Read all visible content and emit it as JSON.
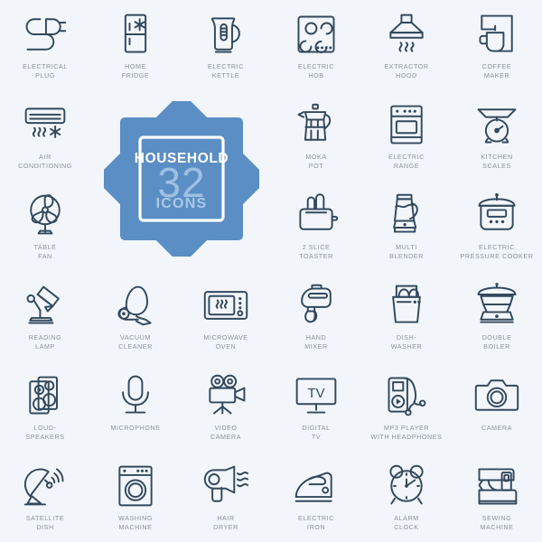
{
  "page": {
    "background_color": "#f2f6fb",
    "icon_stroke_color": "#33485c",
    "label_color": "#8b9199",
    "accent_color": "#5b8ec4",
    "columns": 6,
    "rows": 6
  },
  "badge": {
    "title": "HOUSEHOLD",
    "count": "32",
    "subtitle": "ICONS",
    "shape": "eight-point-star",
    "fill_color": "#5b8ec4",
    "frame_color": "#ffffff",
    "title_color": "#ffffff",
    "count_color": "#9dc0e2",
    "subtitle_color": "#a9c9e6"
  },
  "icons": [
    {
      "id": "electrical-plug",
      "label": "ELECTRICAL\nPLUG",
      "row": 1,
      "col": 1
    },
    {
      "id": "home-fridge",
      "label": "HOME\nFRIDGE",
      "row": 1,
      "col": 2
    },
    {
      "id": "electric-kettle",
      "label": "ELECTRIC\nKETTLE",
      "row": 1,
      "col": 3
    },
    {
      "id": "electric-hob",
      "label": "ELECTRIC\nHOB",
      "row": 1,
      "col": 4
    },
    {
      "id": "extractor-hood",
      "label": "EXTRACTOR\nHOOD",
      "row": 1,
      "col": 5
    },
    {
      "id": "coffee-maker",
      "label": "COFFEE\nMAKER",
      "row": 1,
      "col": 6
    },
    {
      "id": "air-conditioning",
      "label": "AIR\nCONDITIONING",
      "row": 2,
      "col": 1
    },
    {
      "id": "moka-pot",
      "label": "MOKA\nPOT",
      "row": 2,
      "col": 4
    },
    {
      "id": "electric-range",
      "label": "ELECTRIC\nRANGE",
      "row": 2,
      "col": 5
    },
    {
      "id": "kitchen-scales",
      "label": "KITCHEN\nSCALES",
      "row": 2,
      "col": 6
    },
    {
      "id": "table-fan",
      "label": "TABLE\nFAN",
      "row": 3,
      "col": 1
    },
    {
      "id": "two-slice-toaster",
      "label": "2 SLICE\nTOASTER",
      "row": 3,
      "col": 4
    },
    {
      "id": "multi-blender",
      "label": "MULTI\nBLENDER",
      "row": 3,
      "col": 5
    },
    {
      "id": "electric-pressure-cooker",
      "label": "ELECTRIC\nPRESSURE COOKER",
      "row": 3,
      "col": 6
    },
    {
      "id": "reading-lamp",
      "label": "READING\nLAMP",
      "row": 4,
      "col": 1
    },
    {
      "id": "vacuum-cleaner",
      "label": "VACUUM\nCLEANER",
      "row": 4,
      "col": 2
    },
    {
      "id": "microwave-oven",
      "label": "MICROWAVE\nOVEN",
      "row": 4,
      "col": 3
    },
    {
      "id": "hand-mixer",
      "label": "HAND\nMIXER",
      "row": 4,
      "col": 4
    },
    {
      "id": "dishwasher",
      "label": "DISH-\nWASHER",
      "row": 4,
      "col": 5
    },
    {
      "id": "double-boiler",
      "label": "DOUBLE\nBOILER",
      "row": 4,
      "col": 6
    },
    {
      "id": "loudspeakers",
      "label": "LOUD-\nSPEAKERS",
      "row": 5,
      "col": 1
    },
    {
      "id": "microphone",
      "label": "MICROPHONE",
      "row": 5,
      "col": 2
    },
    {
      "id": "video-camera",
      "label": "VIDEO\nCAMERA",
      "row": 5,
      "col": 3
    },
    {
      "id": "digital-tv",
      "label": "DIGITAL\nTV",
      "row": 5,
      "col": 4
    },
    {
      "id": "mp3-player-with-headphones",
      "label": "MP3 PLAYER\nWITH HEADPHONES",
      "row": 5,
      "col": 5
    },
    {
      "id": "camera",
      "label": "CAMERA",
      "row": 5,
      "col": 6
    },
    {
      "id": "satellite-dish",
      "label": "SATELLITE\nDISH",
      "row": 6,
      "col": 1
    },
    {
      "id": "washing-machine",
      "label": "WASHING\nMACHINE",
      "row": 6,
      "col": 2
    },
    {
      "id": "hair-dryer",
      "label": "HAIR\nDRYER",
      "row": 6,
      "col": 3
    },
    {
      "id": "electric-iron",
      "label": "ELECTRIC\nIRON",
      "row": 6,
      "col": 4
    },
    {
      "id": "alarm-clock",
      "label": "ALARM\nCLOCK",
      "row": 6,
      "col": 5
    },
    {
      "id": "sewing-machine",
      "label": "SEWING\nMACHINE",
      "row": 6,
      "col": 6
    }
  ],
  "icon_glyph_text": {
    "digital-tv": "TV"
  }
}
